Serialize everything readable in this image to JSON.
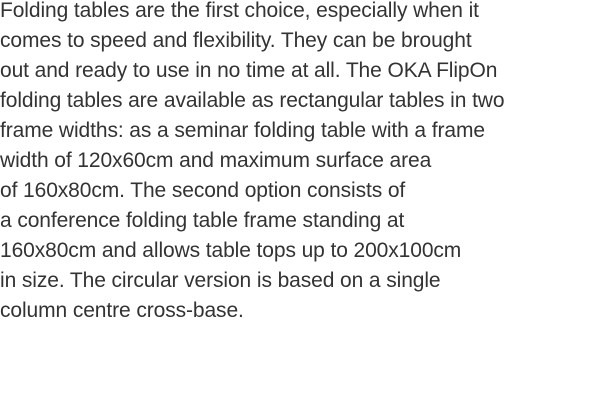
{
  "paragraph": {
    "lines": [
      "Folding tables are the first choice, especially when it",
      "comes to speed and flexibility. They can be brought",
      "out and ready to use in no time at all. The OKA FlipOn",
      "folding tables are available as rectangular tables in two",
      "frame widths: as a seminar folding table with a frame",
      "width of 120x60cm and maximum surface area",
      "of 160x80cm. The second option consists of",
      "a conference folding table frame standing at",
      "160x80cm and allows table tops up to 200x100cm",
      "in size. The circular version is based on a single",
      "column centre cross-base."
    ]
  }
}
